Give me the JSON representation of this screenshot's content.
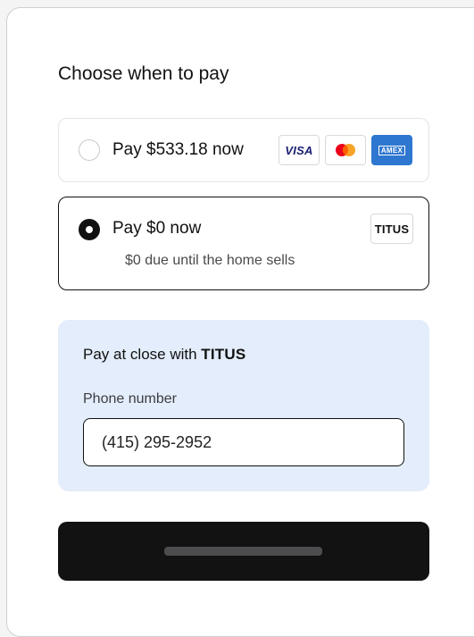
{
  "heading": "Choose when to pay",
  "options": [
    {
      "label": "Pay $533.18 now",
      "selected": false,
      "payment_methods": [
        {
          "name": "VISA",
          "icon": "visa-icon"
        },
        {
          "name": "Mastercard",
          "icon": "mastercard-icon"
        },
        {
          "name": "AMEX",
          "icon": "amex-icon"
        }
      ]
    },
    {
      "label": "Pay $0 now",
      "sublabel": "$0 due until the home sells",
      "selected": true,
      "brand": "TITUS"
    }
  ],
  "panel": {
    "title_prefix": "Pay at close with",
    "title_brand": "TITUS",
    "field_label": "Phone number",
    "phone_value": "(415) 295-2952"
  },
  "colors": {
    "accent": "#111111",
    "panel_bg": "#e3edfb",
    "visa_blue": "#1a1f71",
    "amex_blue": "#2e77d0",
    "mc_red": "#eb001b",
    "mc_orange": "#f79e1b"
  }
}
